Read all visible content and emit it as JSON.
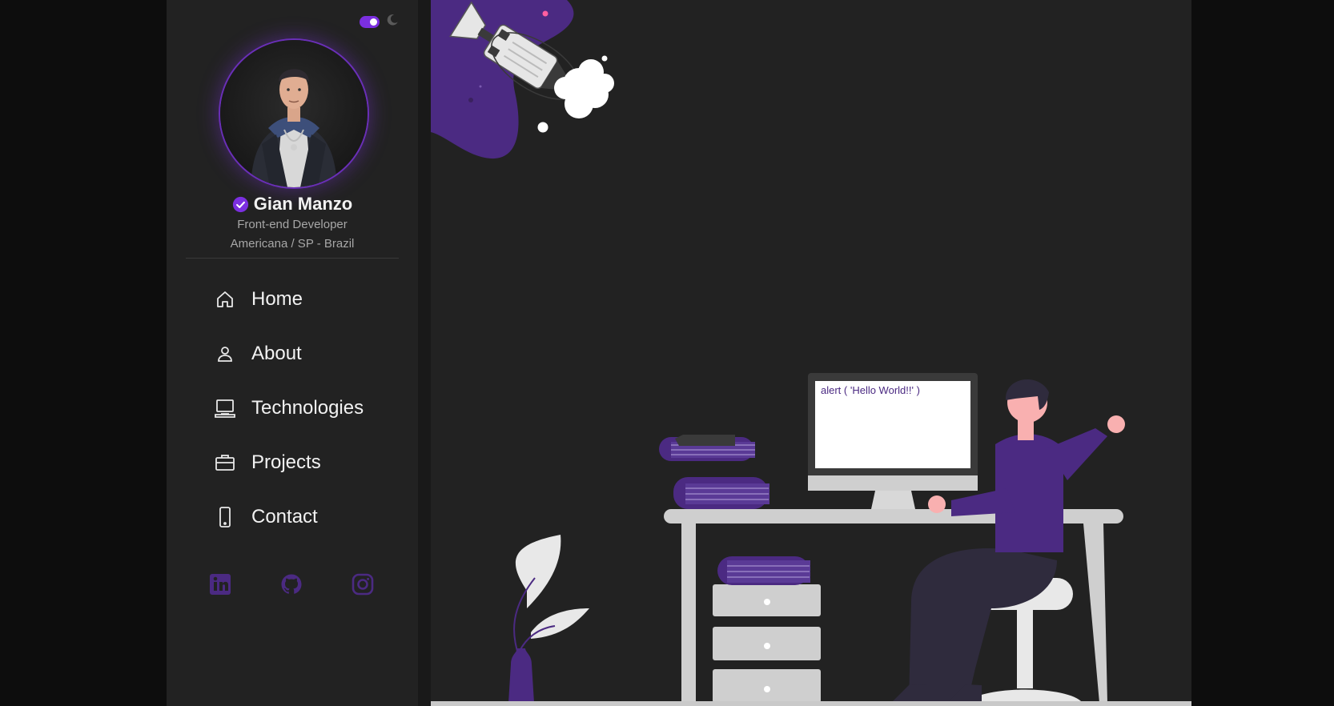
{
  "theme": {
    "accent": "#7b2fe0",
    "illustration_purple": "#4b2a82",
    "dark_mode": true
  },
  "profile": {
    "name": "Gian Manzo",
    "role": "Front-end Developer",
    "location": "Americana / SP - Brazil",
    "verified_icon": "verified-check-icon"
  },
  "nav": {
    "items": [
      {
        "label": "Home",
        "icon": "home-icon"
      },
      {
        "label": "About",
        "icon": "user-icon"
      },
      {
        "label": "Technologies",
        "icon": "laptop-icon"
      },
      {
        "label": "Projects",
        "icon": "briefcase-icon"
      },
      {
        "label": "Contact",
        "icon": "phone-icon"
      }
    ]
  },
  "social": [
    "linkedin-icon",
    "github-icon",
    "instagram-icon"
  ],
  "illustration": {
    "screen_code": "alert ( 'Hello World!!' )"
  }
}
